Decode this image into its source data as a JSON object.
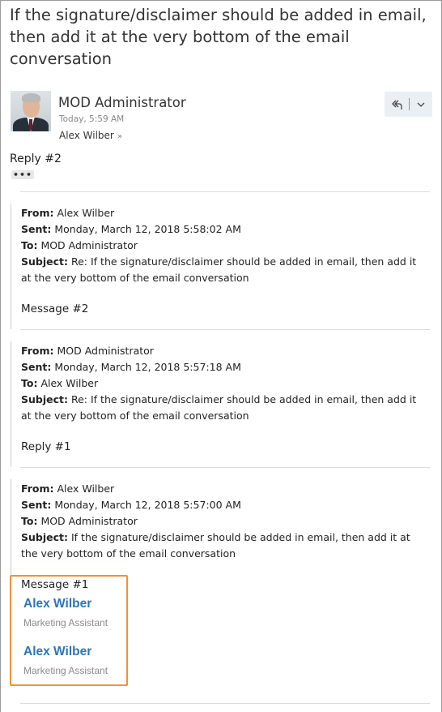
{
  "subject": "If the signature/disclaimer should be added in email, then add it at the very bottom of the email conversation",
  "message": {
    "sender": "MOD Administrator",
    "time": "Today, 5:59 AM",
    "to": "Alex Wilber",
    "body": "Reply #2"
  },
  "icons": {
    "avatar": "avatar-photo",
    "reply_all": "reply-all-icon",
    "more": "chevron-down-icon",
    "expand_recipients": "double-chevron-down-icon",
    "show_trimmed": "ellipsis-icon"
  },
  "labels": {
    "from": "From:",
    "sent": "Sent:",
    "to": "To:",
    "subject": "Subject:"
  },
  "quoted": [
    {
      "from": "Alex Wilber",
      "sent": "Monday, March 12, 2018 5:58:02 AM",
      "to": "MOD Administrator",
      "subject": "Re: If the signature/disclaimer should be added in email, then add it at the very bottom of the email conversation",
      "body": "Message #2"
    },
    {
      "from": "MOD Administrator",
      "sent": "Monday, March 12, 2018 5:57:18 AM",
      "to": "Alex Wilber",
      "subject": "Re: If the signature/disclaimer should be added in email, then add it at the very bottom of the email conversation",
      "body": "Reply #1"
    },
    {
      "from": "Alex Wilber",
      "sent": "Monday, March 12, 2018 5:57:00 AM",
      "to": "MOD Administrator",
      "subject": "If the signature/disclaimer should be added in email, then add it at the very bottom of the email conversation",
      "body": "Message #1"
    }
  ],
  "signatures": [
    {
      "name": "Alex Wilber",
      "title": "Marketing Assistant"
    },
    {
      "name": "Alex Wilber",
      "title": "Marketing Assistant"
    }
  ],
  "colors": {
    "highlight": "#f0913a",
    "signature_name": "#2e75b6",
    "action_bg": "#eaeff4"
  }
}
